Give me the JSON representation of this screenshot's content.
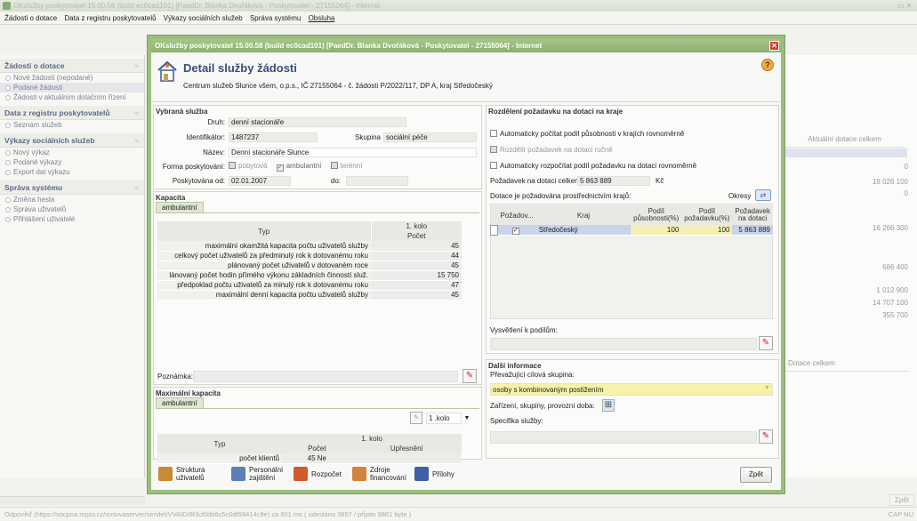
{
  "window": {
    "title": "OKslužby poskytovatel 15.00.58 (build ec0cad101)  [PaedDr. Blanka Dvořáková - Poskytovatel - 27155064] - Internet"
  },
  "menu": [
    {
      "label": "Žádosti o dotace",
      "ul": "Ž"
    },
    {
      "label": "Data z registru poskytovatelů"
    },
    {
      "label": "Výkazy sociálních služeb"
    },
    {
      "label": "Správa systému"
    },
    {
      "label": "Obsluha"
    }
  ],
  "sidebar": {
    "groups": [
      {
        "title": "Žádosti o dotace",
        "items": [
          {
            "label": "Nové žádosti (nepodané)"
          },
          {
            "label": "Podané žádosti",
            "selected": true
          },
          {
            "label": "Žádosti v aktuálním dotačním řízení"
          }
        ]
      },
      {
        "title": "Data z registru poskytovatelů",
        "items": [
          {
            "label": "Seznam služeb"
          }
        ]
      },
      {
        "title": "Výkazy sociálních služeb",
        "items": [
          {
            "label": "Nový výkaz"
          },
          {
            "label": "Podané výkazy"
          },
          {
            "label": "Export dat výkazu"
          }
        ]
      },
      {
        "title": "Správa systému",
        "items": [
          {
            "label": "Změna hesla"
          },
          {
            "label": "Správa uživatelů"
          },
          {
            "label": "Přihlášení uživatelé"
          }
        ]
      }
    ]
  },
  "background": {
    "col_header": "Aktuální dotace celkem",
    "values": [
      "0",
      "19 026 100",
      "0",
      "16 266 300",
      "686 400",
      "1 012 900",
      "14 707 100",
      "355 700"
    ],
    "col_header2": "Dotace celkem",
    "zpet": "Zpět",
    "status": "Odpověď (https://socpoa.mpsv.cz/sosvvaserver/servlet/VVAID/8f3cf0db6c5c0df59414c9e) za 601 ms ( odesláno 3657 / přijato 9861 byte )",
    "status_right": "CAP  NU"
  },
  "dialog": {
    "title": "OKslužby poskytovatel 15.00.58 (build ec0cad101)  [PaedDr. Blanka Dvořáková - Poskytovatel - 27155064] - Internet",
    "close_label": "✕",
    "header": {
      "title": "Detail služby žádosti",
      "subtitle": "Centrum služeb Slunce všem, o.p.s., IČ 27155064 - č. žádosti P/2022/117, DP A, kraj Středočeský"
    },
    "vybrana": {
      "title": "Vybraná služba",
      "druh_label": "Druh:",
      "druh": "denní stacionáře",
      "id_label": "Identifikátor:",
      "id": "1487237",
      "skupina_label": "Skupina",
      "skupina": "sociální péče",
      "nazev_label": "Název:",
      "nazev": "Denní stacionáře Slunce",
      "forma_label": "Forma poskytování:",
      "forma": [
        {
          "label": "pobytová",
          "checked": false
        },
        {
          "label": "ambulantní",
          "checked": true
        },
        {
          "label": "terénní",
          "checked": false
        }
      ],
      "od_label": "Poskytována od:",
      "od": "02.01.2007",
      "do_label": "do:",
      "do": ""
    },
    "kapacita": {
      "title": "Kapacita",
      "tab": "ambulantní",
      "col_typ": "Typ",
      "col_kolo": "1. kolo",
      "col_pocet": "Počet",
      "rows": [
        {
          "typ": "maximální okamžitá kapacita počtu uživatelů služby",
          "pocet": "45"
        },
        {
          "typ": "celkový počet uživatelů za předminulý rok k dotovanému roku",
          "pocet": "44"
        },
        {
          "typ": "plánovaný počet uživatelů v dotovaném roce",
          "pocet": "45"
        },
        {
          "typ": "lánovaný počet hodin přímého výkonu základních činností služ.",
          "pocet": "15 750"
        },
        {
          "typ": "předpoklad počtu uživatelů za minulý rok k dotovanému roku",
          "pocet": "47"
        },
        {
          "typ": "maximální denní kapacita počtu uživatelů služby",
          "pocet": "45"
        }
      ],
      "poznamka_label": "Poznámka:"
    },
    "maxkap": {
      "title": "Maximální kapacita",
      "tab": "ambulantní",
      "kolo_select": "1 .kolo",
      "col_typ": "Typ",
      "col_kolo": "1. kolo",
      "col_pocet": "Počet",
      "col_upr": "Upřesnění",
      "rows": [
        {
          "typ": "počet klientů",
          "pocet": "45 Ne",
          "upr": ""
        }
      ]
    },
    "rozdeleni": {
      "title": "Rozdělení požadavku na dotaci na kraje",
      "cb1": "Automaticky počítat podíl působnosti v krajích rovnoměrně",
      "cb2": "Rozdělit požadavek na dotaci ručně",
      "cb3": "Automaticky rozpočítat podíl požadavku na dotaci rovnoměrně",
      "pozadavek_label": "Požadavek na dotaci celkem:",
      "pozadavek": "5 863 889",
      "mena": "Kč",
      "dotace_label": "Dotace je požadována prostřednictvím krajů:",
      "okresy": "Okresy",
      "cols": [
        "Požadov...",
        "Kraj",
        "Podíl působnosti(%)",
        "Podíl požadavku(%)",
        "Požadavek na dotaci"
      ],
      "rows": [
        {
          "kraj": "Středočeský",
          "p1": "100",
          "p2": "100",
          "poz": "5 863 889"
        }
      ],
      "vysvetleni_label": "Vysvětlení k podílům:"
    },
    "dalsi": {
      "title": "Další informace",
      "cilova_label": "Převažující cílová skupina:",
      "cilova": "osoby s kombinovaným postižením",
      "zarizeni_label": "Zařízení, skupiny, provozní doba:",
      "specifika_label": "Specifika služby:"
    },
    "buttons": [
      {
        "l1": "Struktura",
        "l2": "uživatelů",
        "color": "#c98a34"
      },
      {
        "l1": "Personální",
        "l2": "zajištění",
        "color": "#5c7fb8"
      },
      {
        "l1": "Rozpočet",
        "l2": "",
        "color": "#d25a2b"
      },
      {
        "l1": "Zdroje",
        "l2": "financování",
        "color": "#d0833a"
      },
      {
        "l1": "Přílohy",
        "l2": "",
        "color": "#3f5fa6"
      }
    ],
    "zpet": "Zpět"
  }
}
